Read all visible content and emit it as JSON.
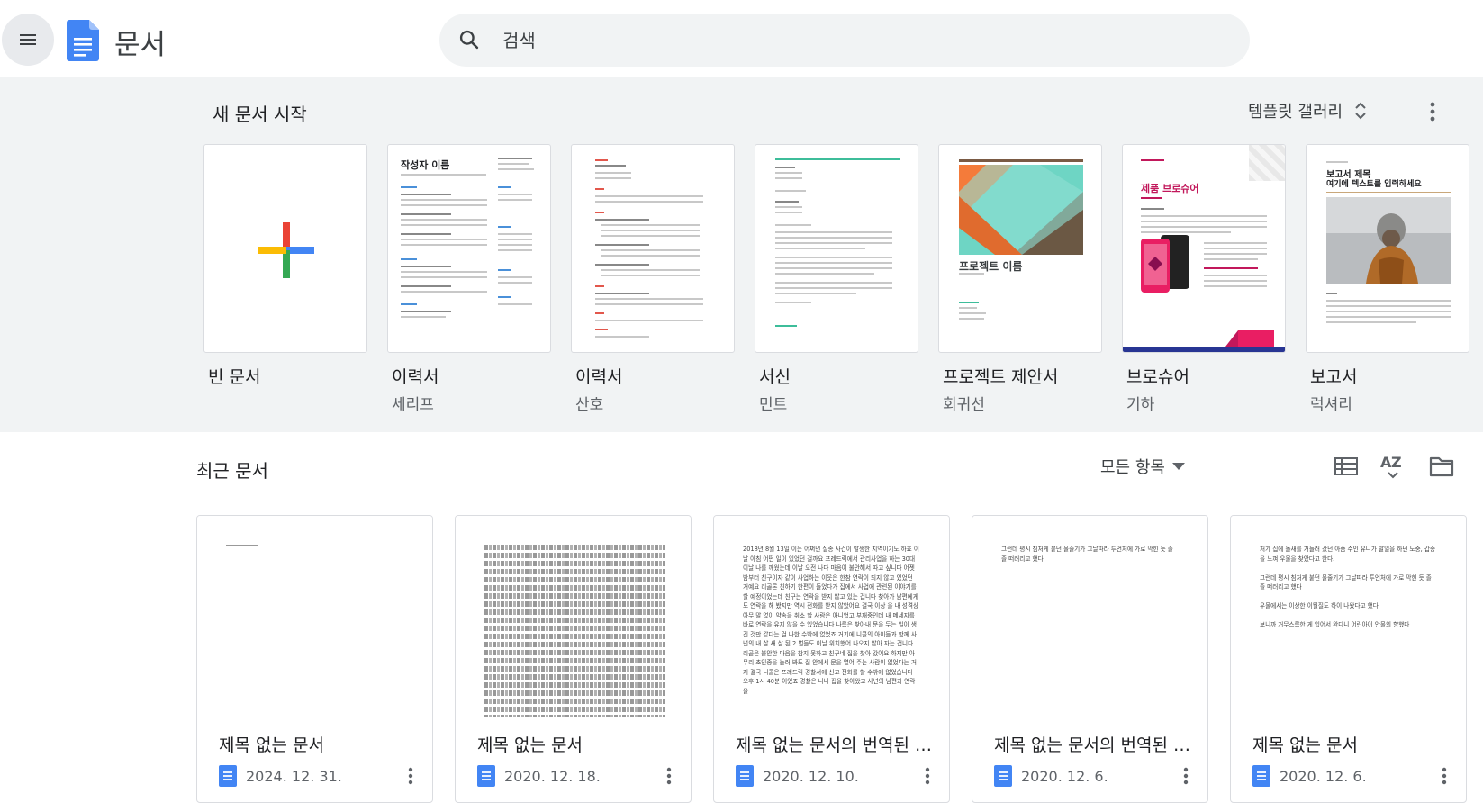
{
  "header": {
    "menu_icon": "hamburger-menu-icon",
    "app_title": "문서",
    "search_placeholder": "검색"
  },
  "templates_section": {
    "title": "새 문서 시작",
    "gallery_label": "템플릿 갤러리",
    "items": [
      {
        "name": "빈 문서",
        "sub": ""
      },
      {
        "name": "이력서",
        "sub": "세리프",
        "preview_heading": "작성자 이름"
      },
      {
        "name": "이력서",
        "sub": "산호"
      },
      {
        "name": "서신",
        "sub": "민트"
      },
      {
        "name": "프로젝트 제안서",
        "sub": "회귀선",
        "preview_heading": "프로젝트 이름"
      },
      {
        "name": "브로슈어",
        "sub": "기하",
        "preview_heading": "제품 브로슈어"
      },
      {
        "name": "보고서",
        "sub": "럭셔리",
        "preview_heading": "보고서 제목",
        "preview_subheading": "여기에 텍스트를 입력하세요"
      }
    ]
  },
  "recent_section": {
    "title": "최근 문서",
    "owner_filter": "모든 항목",
    "docs": [
      {
        "title": "제목 없는 문서",
        "date": "2024. 12. 31."
      },
      {
        "title": "제목 없는 문서",
        "date": "2020. 12. 18."
      },
      {
        "title": "제목 없는 문서의 번역된 사본",
        "date": "2020. 12. 10.",
        "preview": "2018년 8월 13일 이는 어쩌면 실종 사건이 발생한 지역이기도 하죠 이날 아침 어떤 일이 있었던 걸까요 프레드릭에서 관리사업을 하는 30대 이날 나를 깨웠는데 이날 오전 나다 마음이 불안해서 따고 싶니다 어젯밤부터 친구이자 같이 사업하는 이웃은 한참 연락이 되지 않고 있었던 거예요 리골론 친하기 한편이 들었다가 집에서 사업에 관련된 이야기를 할 예정이었는데 친구는 연락을 받지 않고 있는 겁니다 찾아가 남편에게도 연락을 해 봤지만 역시 전화를 받지 않았어요 결국 이상 을 내 성격상 아무 말 없이 약속을 취소 할 사람은 아니었고 부재중인데 내 메세지를 바로 연락을 유지 않을 수 있었습니다 나름은 찾아내 문을 두는 일이 생긴 것만 같다는 걸 나한 수밖에 없었죠 거기에 니콜의 아이들과 함께 사넌의 내 살 새 살 된 2 벌들도 이날 위치했어 나오지 않아 자는 겁니다 리골은 불안한 마음을 참지 못하고 친구네 집을 찾아 갔어요 하지만 아무리 초인종을 눌러 봐도 집 안에서 문을 열어 주는 사람이 없었다는 거지 결국 니콜은 프레드릭 경찰서에 신고 전화를 할 수밖에 없었습니다 오후 1시 40분 이었죠 경찰은 나니 집을 찾아왔고 사넌의 남편과 연락을"
      },
      {
        "title": "제목 없는 문서의 번역된 사본",
        "date": "2020. 12. 6.",
        "preview": "그런데 평시 침처게 붙던 물줄기가 그날따라 투언처에 가로 막힌 듯 졸졸 떠러리고 했다"
      },
      {
        "title": "제목 없는 문서",
        "date": "2020. 12. 6.",
        "preview": "처가 집에 놀새를 거들러 갔던 아줌 주인 유니가 발일을 하던 도중, 갑종을 느껴 우물을 찾았다고 한다.\n\n그런데 평시 침처게 붙던 물줄기가 그날따라 투언처에 가로 막힌 듯 졸졸 떠러리고 했다\n\n우물에서는 이상한 이월질도 하이 나왔다고 했다\n\n보니까 거무스름한 게 있어서 완다니 어린아이 안물의 향했다"
      }
    ]
  },
  "colors": {
    "header_bg": "#ffffff",
    "template_bg": "#f1f3f4",
    "docs_blue": "#4285f4",
    "search_bg": "#f1f3f4"
  }
}
